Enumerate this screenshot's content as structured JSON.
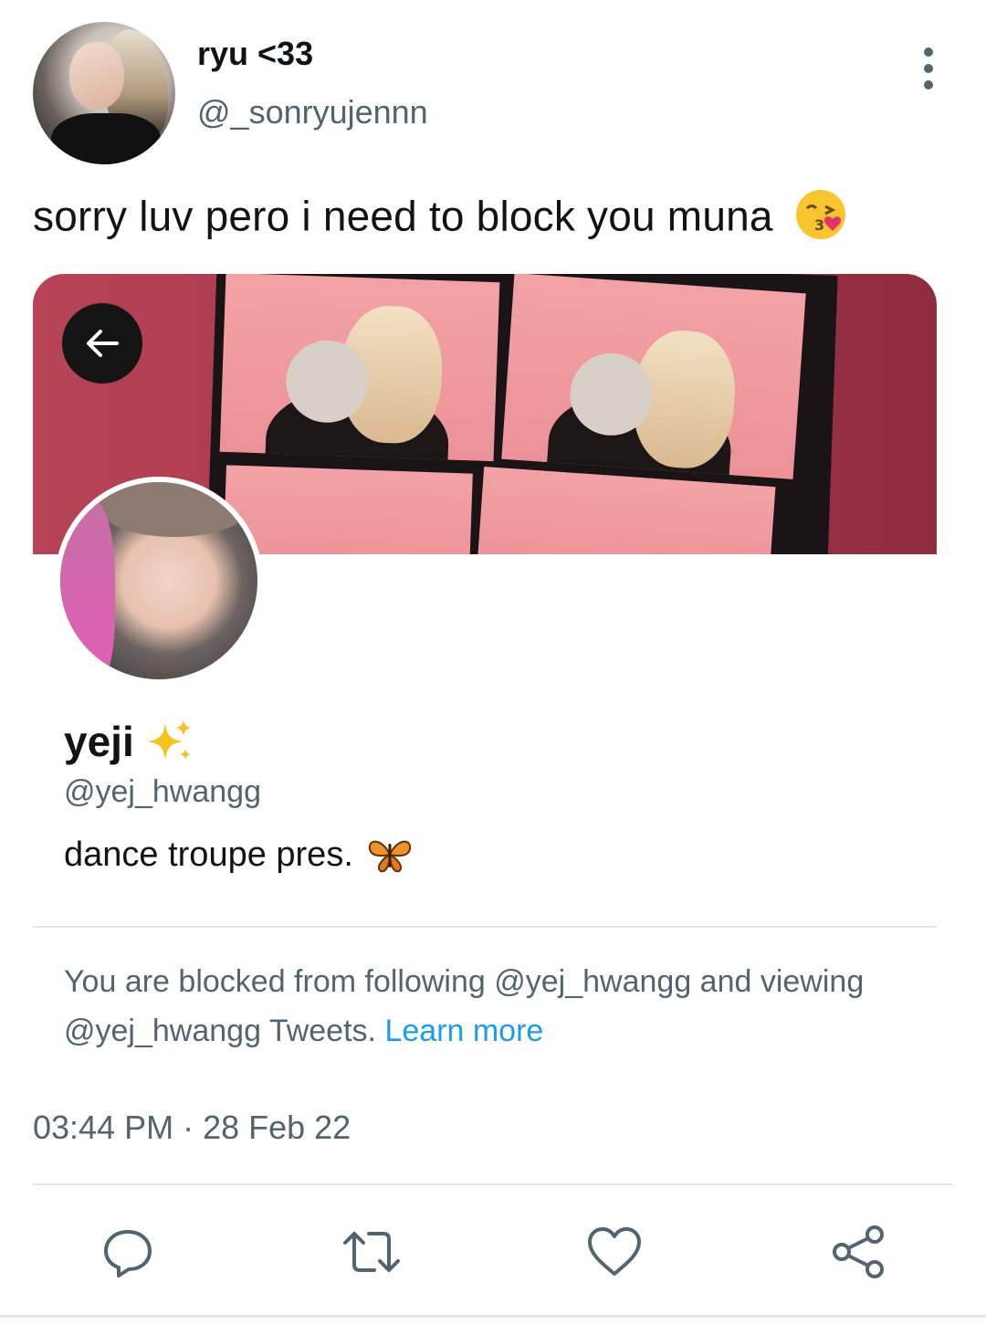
{
  "tweet": {
    "author": {
      "display_name": "ryu <33",
      "handle": "@_sonryujennn"
    },
    "text": "sorry luv pero i need to block you muna",
    "text_emoji": "kissing-face-with-heart-emoji",
    "timestamp": "03:44 PM · 28 Feb 22"
  },
  "embedded_profile": {
    "display_name": "yeji",
    "name_emoji": "sparkles-emoji",
    "handle": "@yej_hwangg",
    "bio": "dance troupe pres.",
    "bio_emoji": "butterfly-emoji",
    "blocked_notice": "You are blocked from following @yej_hwangg and viewing @yej_hwangg Tweets.",
    "learn_more": "Learn more"
  },
  "icons": {
    "back": "arrow-left-icon",
    "more": "more-vertical-icon",
    "actions": [
      "reply-icon",
      "retweet-icon",
      "like-icon",
      "share-icon"
    ]
  },
  "colors": {
    "text_primary": "#0f1419",
    "text_secondary": "#536471",
    "link": "#1d9bf0",
    "icon": "#536471"
  }
}
